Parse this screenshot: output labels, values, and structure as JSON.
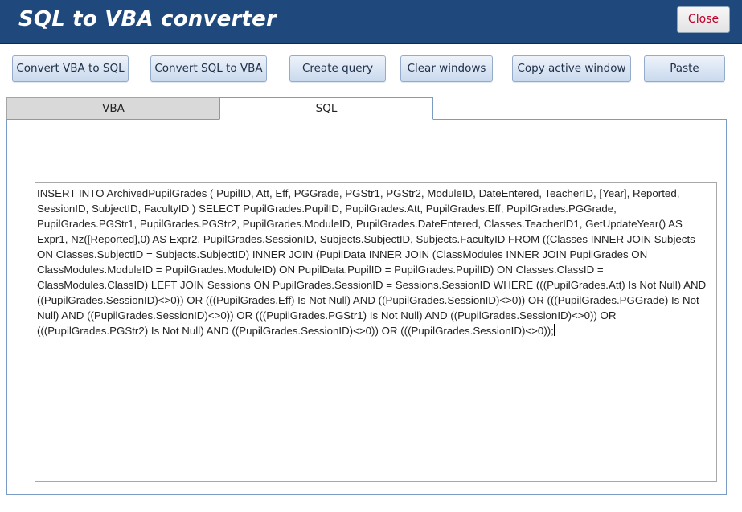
{
  "window": {
    "title": "SQL to VBA converter",
    "close_label": "Close"
  },
  "toolbar": {
    "convert_vba_to_sql": "Convert VBA to SQL",
    "convert_sql_to_vba": "Convert SQL to VBA",
    "create_query": "Create query",
    "clear_windows": "Clear windows",
    "copy_active_window": "Copy active window",
    "paste": "Paste"
  },
  "tabs": {
    "vba_accel": "V",
    "vba_rest": "BA",
    "sql_accel": "S",
    "sql_rest": "QL",
    "active": "SQL"
  },
  "sql_text": "INSERT INTO ArchivedPupilGrades ( PupilID, Att, Eff, PGGrade, PGStr1, PGStr2, ModuleID, DateEntered, TeacherID, [Year], Reported, SessionID, SubjectID, FacultyID ) SELECT PupilGrades.PupilID, PupilGrades.Att, PupilGrades.Eff, PupilGrades.PGGrade, PupilGrades.PGStr1, PupilGrades.PGStr2, PupilGrades.ModuleID, PupilGrades.DateEntered, Classes.TeacherID1, GetUpdateYear() AS Expr1, Nz([Reported],0) AS Expr2, PupilGrades.SessionID, Subjects.SubjectID, Subjects.FacultyID FROM ((Classes INNER JOIN Subjects ON Classes.SubjectID = Subjects.SubjectID) INNER JOIN (PupilData INNER JOIN (ClassModules INNER JOIN PupilGrades ON ClassModules.ModuleID = PupilGrades.ModuleID) ON PupilData.PupilID = PupilGrades.PupilID) ON Classes.ClassID = ClassModules.ClassID) LEFT JOIN Sessions ON PupilGrades.SessionID = Sessions.SessionID WHERE (((PupilGrades.Att) Is Not Null) AND ((PupilGrades.SessionID)<>0)) OR (((PupilGrades.Eff) Is Not Null) AND ((PupilGrades.SessionID)<>0)) OR (((PupilGrades.PGGrade) Is Not Null) AND ((PupilGrades.SessionID)<>0)) OR (((PupilGrades.PGStr1) Is Not Null) AND ((PupilGrades.SessionID)<>0)) OR (((PupilGrades.PGStr2) Is Not Null) AND ((PupilGrades.SessionID)<>0)) OR (((PupilGrades.SessionID)<>0));",
  "colors": {
    "header_bg": "#1f497d",
    "close_text": "#c0002a",
    "button_top": "#eef3fa",
    "button_bottom": "#c9d9ee",
    "tab_border": "#7a9cc4"
  }
}
